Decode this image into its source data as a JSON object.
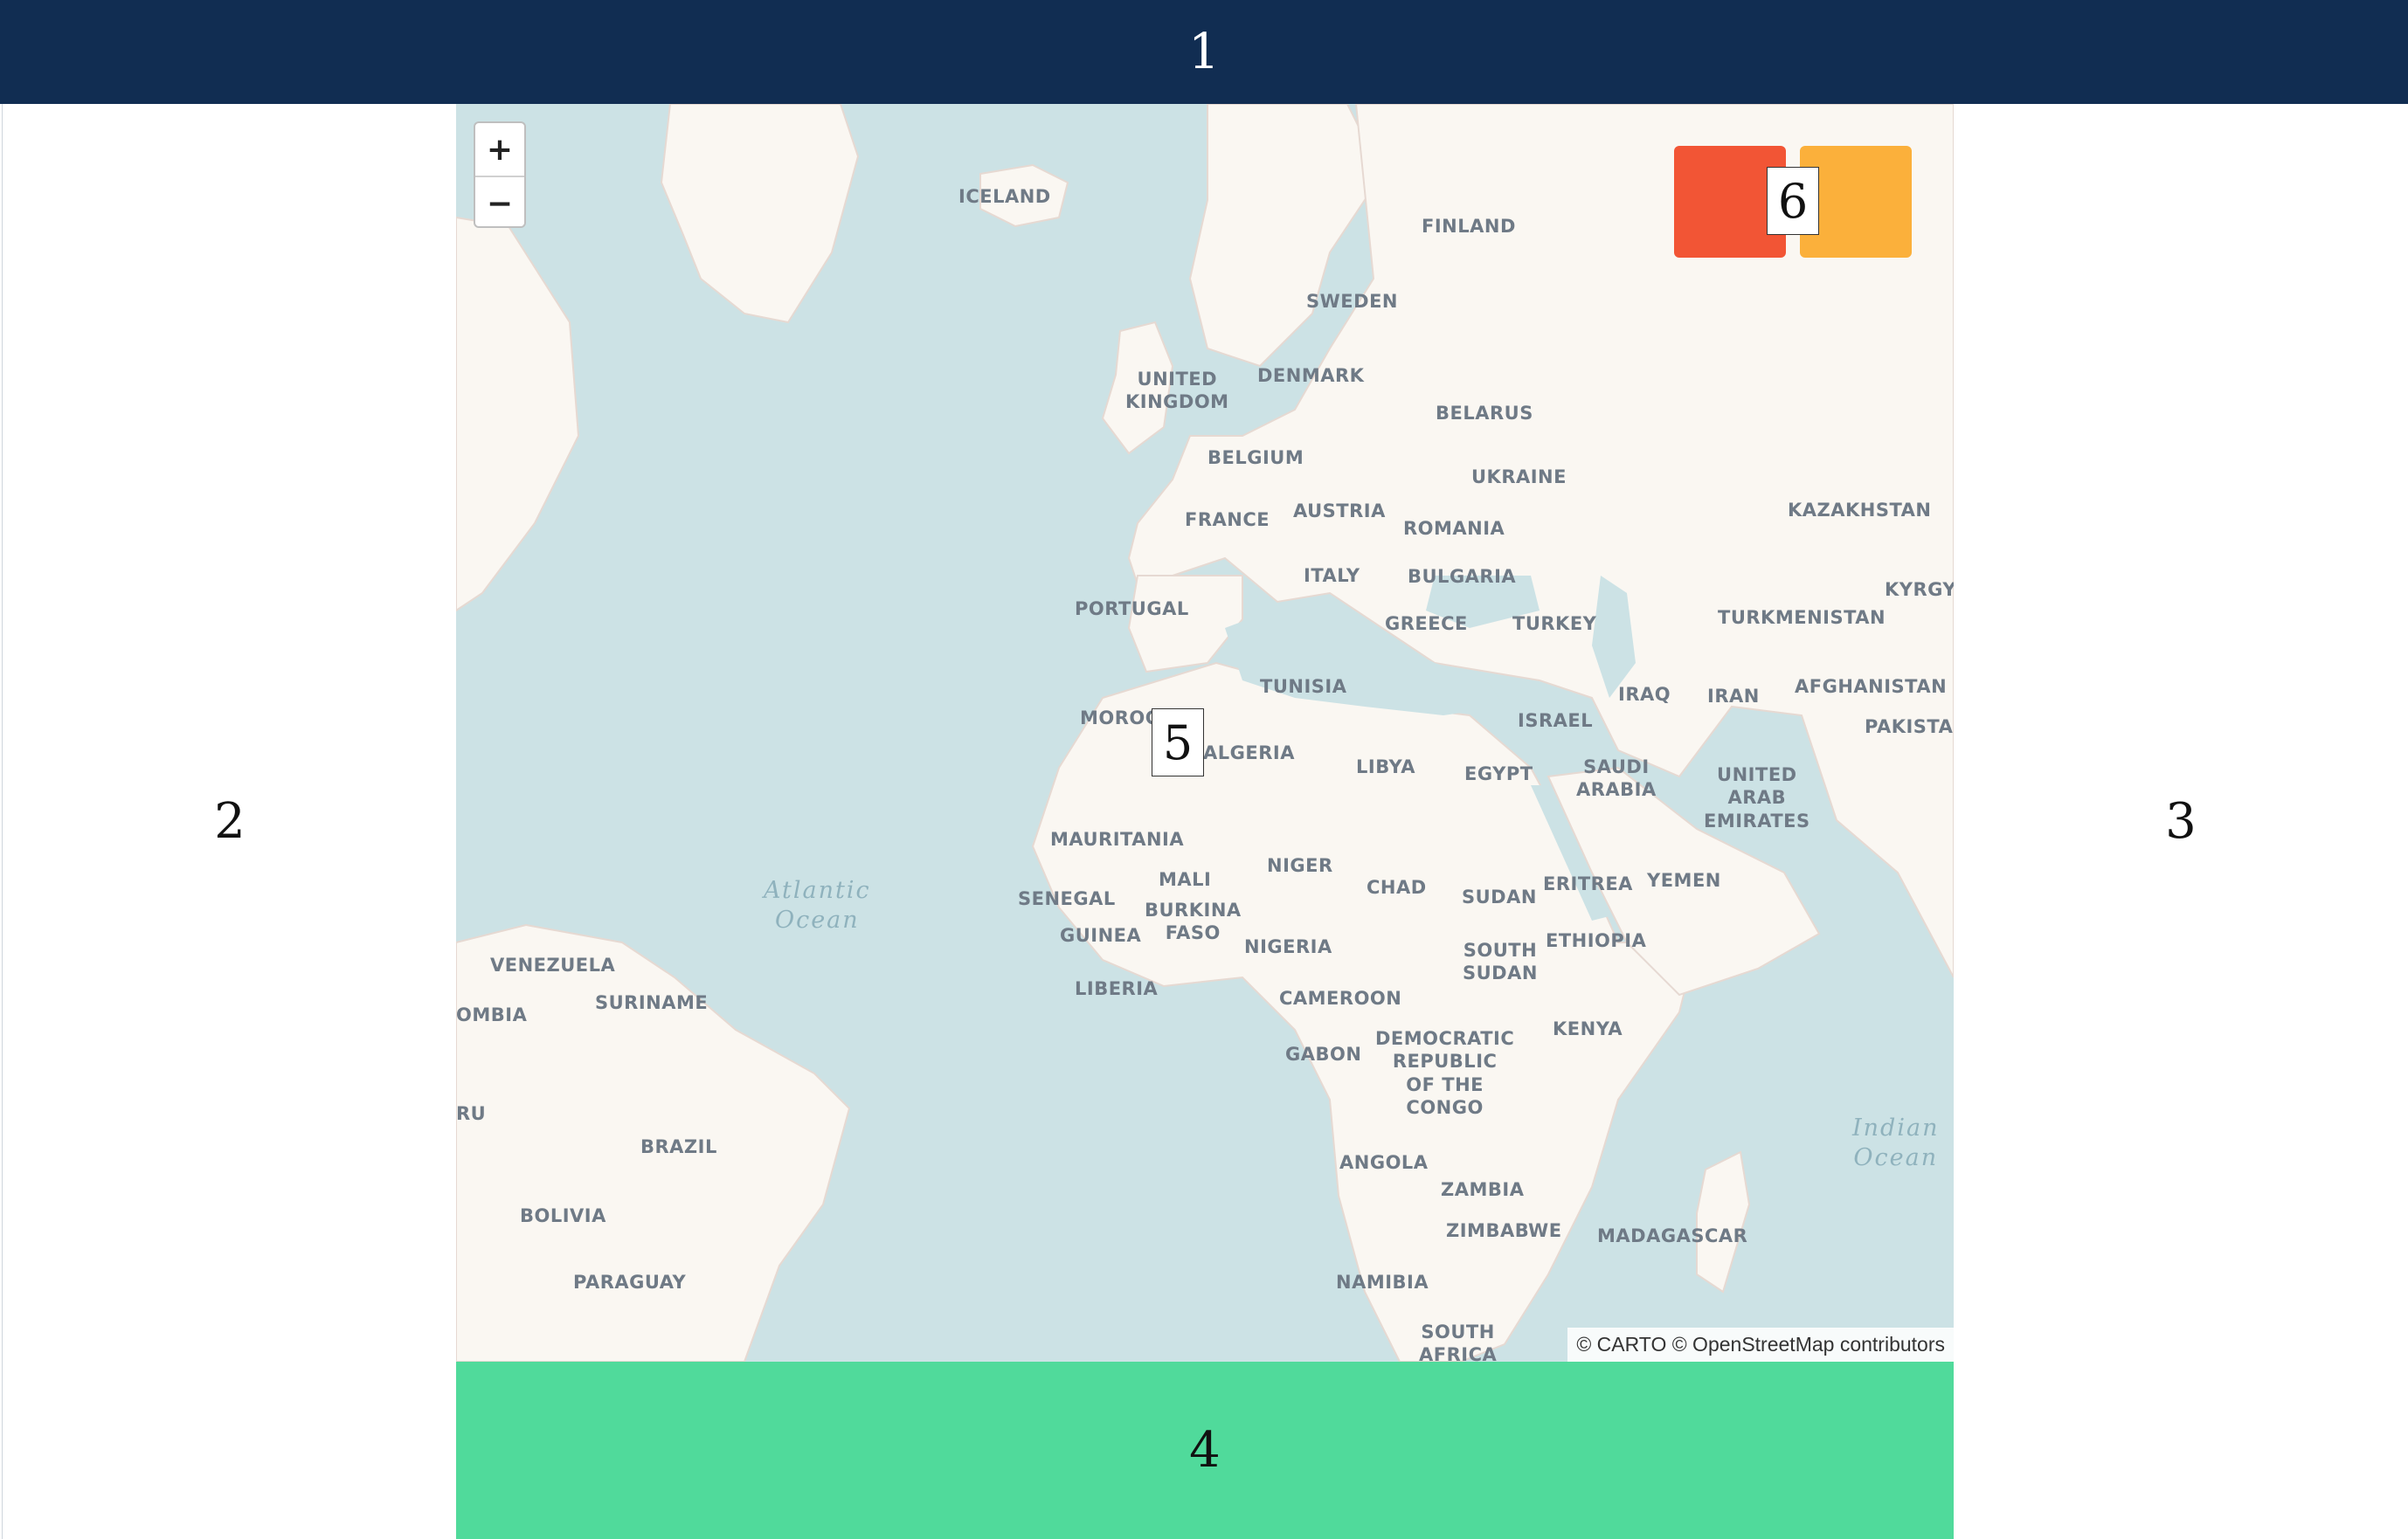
{
  "header": {
    "label": "1"
  },
  "left_panel": {
    "label": "2"
  },
  "right_panel": {
    "label": "3"
  },
  "footer": {
    "label": "4"
  },
  "map": {
    "marker_label": "5",
    "legend_label": "6",
    "zoom_in": "+",
    "zoom_out": "−",
    "attribution": "© CARTO © OpenStreetMap contributors",
    "swatch_colors": {
      "red": "#f25535",
      "orange": "#fbb03b"
    },
    "country_labels": {
      "iceland": "ICELAND",
      "finland": "FINLAND",
      "sweden": "SWEDEN",
      "united_kingdom": "UNITED\nKINGDOM",
      "denmark": "DENMARK",
      "belarus": "BELARUS",
      "belgium": "BELGIUM",
      "ukraine": "UKRAINE",
      "kazakhstan": "KAZAKHSTAN",
      "france": "FRANCE",
      "austria": "AUSTRIA",
      "romania": "ROMANIA",
      "italy": "ITALY",
      "bulgaria": "BULGARIA",
      "kyrgyz": "KYRGYZ",
      "portugal": "PORTUGAL",
      "greece": "GREECE",
      "turkey": "TURKEY",
      "turkmenistan": "TURKMENISTAN",
      "tunisia": "TUNISIA",
      "iraq": "IRAQ",
      "iran": "IRAN",
      "afghanistan": "AFGHANISTAN",
      "moroc": "MOROC",
      "israel": "ISRAEL",
      "pakistan": "PAKISTAN",
      "algeria": "ALGERIA",
      "libya": "LIBYA",
      "egypt": "EGYPT",
      "saudi_arabia": "SAUDI\nARABIA",
      "uae": "UNITED\nARAB\nEMIRATES",
      "mauritania": "MAURITANIA",
      "niger": "NIGER",
      "mali": "MALI",
      "chad": "CHAD",
      "sudan": "SUDAN",
      "eritrea": "ERITREA",
      "yemen": "YEMEN",
      "senegal": "SENEGAL",
      "burkina_faso": "BURKINA\nFASO",
      "guinea": "GUINEA",
      "nigeria": "NIGERIA",
      "south_sudan": "SOUTH\nSUDAN",
      "ethiopia": "ETHIOPIA",
      "venezuela": "VENEZUELA",
      "suriname": "SURINAME",
      "liberia": "LIBERIA",
      "cameroon": "CAMEROON",
      "colombia": "OMBIA",
      "kenya": "KENYA",
      "gabon": "GABON",
      "drc": "DEMOCRATIC\nREPUBLIC\nOF THE\nCONGO",
      "peru": "RU",
      "brazil": "BRAZIL",
      "angola": "ANGOLA",
      "zambia": "ZAMBIA",
      "bolivia": "BOLIVIA",
      "zimbabwe": "ZIMBABWE",
      "madagascar": "MADAGASCAR",
      "paraguay": "PARAGUAY",
      "namibia": "NAMIBIA",
      "south_africa": "SOUTH\nAFRICA"
    },
    "ocean_labels": {
      "atlantic": "Atlantic\nOcean",
      "indian": "Indian\nOcean"
    }
  }
}
